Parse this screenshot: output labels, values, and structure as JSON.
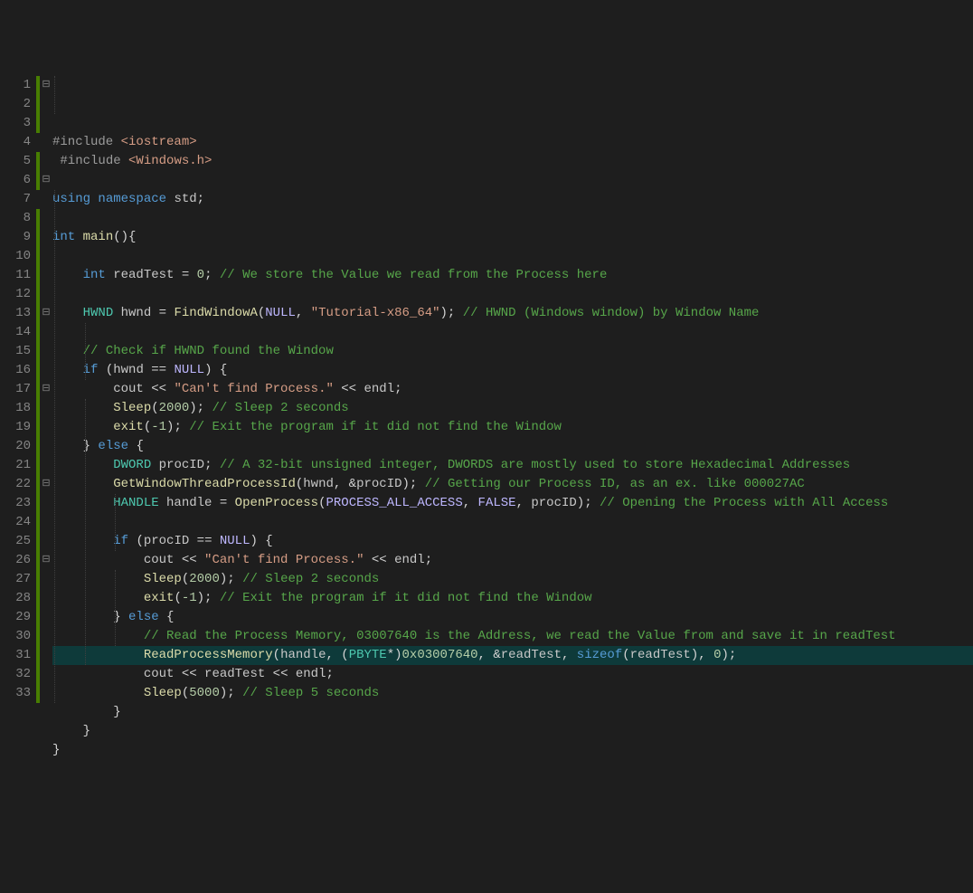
{
  "lineCount": 33,
  "modified": [
    1,
    2,
    3,
    5,
    6,
    8,
    9,
    10,
    11,
    12,
    13,
    14,
    15,
    16,
    17,
    18,
    19,
    20,
    21,
    22,
    23,
    24,
    25,
    26,
    27,
    28,
    29,
    30,
    31,
    32,
    33
  ],
  "fold": {
    "minus": [
      1,
      6,
      13,
      17,
      22,
      26
    ],
    "open": []
  },
  "lines": [
    [
      [
        "pp",
        "#include "
      ],
      [
        "str",
        "<iostream>"
      ]
    ],
    [
      [
        "op",
        " "
      ],
      [
        "pp",
        "#include "
      ],
      [
        "str",
        "<Windows.h>"
      ]
    ],
    [],
    [
      [
        "kw",
        "using "
      ],
      [
        "kw",
        "namespace "
      ],
      [
        "gv",
        "std"
      ],
      [
        "op",
        ";"
      ]
    ],
    [],
    [
      [
        "kw",
        "int "
      ],
      [
        "fn",
        "main"
      ],
      [
        "op",
        "(){"
      ]
    ],
    [],
    [
      [
        "op",
        "    "
      ],
      [
        "kw",
        "int "
      ],
      [
        "gv",
        "readTest"
      ],
      [
        "op",
        " = "
      ],
      [
        "num",
        "0"
      ],
      [
        "op",
        "; "
      ],
      [
        "cm",
        "// We store the Value we read from the Process here"
      ]
    ],
    [],
    [
      [
        "op",
        "    "
      ],
      [
        "ty",
        "HWND "
      ],
      [
        "gv",
        "hwnd"
      ],
      [
        "op",
        " = "
      ],
      [
        "fn",
        "FindWindowA"
      ],
      [
        "op",
        "("
      ],
      [
        "mac",
        "NULL"
      ],
      [
        "op",
        ", "
      ],
      [
        "str",
        "\"Tutorial-x86_64\""
      ],
      [
        "op",
        "); "
      ],
      [
        "cm",
        "// HWND (Windows window) by Window Name"
      ]
    ],
    [],
    [
      [
        "op",
        "    "
      ],
      [
        "cm",
        "// Check if HWND found the Window"
      ]
    ],
    [
      [
        "op",
        "    "
      ],
      [
        "kw",
        "if "
      ],
      [
        "op",
        "("
      ],
      [
        "gv",
        "hwnd"
      ],
      [
        "op",
        " == "
      ],
      [
        "mac",
        "NULL"
      ],
      [
        "op",
        ") {"
      ]
    ],
    [
      [
        "op",
        "        "
      ],
      [
        "gv",
        "cout"
      ],
      [
        "op",
        " << "
      ],
      [
        "str",
        "\"Can't find Process.\""
      ],
      [
        "op",
        " << "
      ],
      [
        "gv",
        "endl"
      ],
      [
        "op",
        ";"
      ]
    ],
    [
      [
        "op",
        "        "
      ],
      [
        "fn",
        "Sleep"
      ],
      [
        "op",
        "("
      ],
      [
        "num",
        "2000"
      ],
      [
        "op",
        "); "
      ],
      [
        "cm",
        "// Sleep 2 seconds"
      ]
    ],
    [
      [
        "op",
        "        "
      ],
      [
        "fn",
        "exit"
      ],
      [
        "op",
        "("
      ],
      [
        "num",
        "-1"
      ],
      [
        "op",
        "); "
      ],
      [
        "cm",
        "// Exit the program if it did not find the Window"
      ]
    ],
    [
      [
        "op",
        "    } "
      ],
      [
        "kw",
        "else "
      ],
      [
        "op",
        "{"
      ]
    ],
    [
      [
        "op",
        "        "
      ],
      [
        "ty",
        "DWORD "
      ],
      [
        "gv",
        "procID"
      ],
      [
        "op",
        "; "
      ],
      [
        "cm",
        "// A 32-bit unsigned integer, DWORDS are mostly used to store Hexadecimal Addresses"
      ]
    ],
    [
      [
        "op",
        "        "
      ],
      [
        "fn",
        "GetWindowThreadProcessId"
      ],
      [
        "op",
        "("
      ],
      [
        "gv",
        "hwnd"
      ],
      [
        "op",
        ", &"
      ],
      [
        "gv",
        "procID"
      ],
      [
        "op",
        "); "
      ],
      [
        "cm",
        "// Getting our Process ID, as an ex. like 000027AC"
      ]
    ],
    [
      [
        "op",
        "        "
      ],
      [
        "ty",
        "HANDLE "
      ],
      [
        "gv",
        "handle"
      ],
      [
        "op",
        " = "
      ],
      [
        "fn",
        "OpenProcess"
      ],
      [
        "op",
        "("
      ],
      [
        "mac",
        "PROCESS_ALL_ACCESS"
      ],
      [
        "op",
        ", "
      ],
      [
        "mac",
        "FALSE"
      ],
      [
        "op",
        ", "
      ],
      [
        "gv",
        "procID"
      ],
      [
        "op",
        "); "
      ],
      [
        "cm",
        "// Opening the Process with All Access"
      ]
    ],
    [],
    [
      [
        "op",
        "        "
      ],
      [
        "kw",
        "if "
      ],
      [
        "op",
        "("
      ],
      [
        "gv",
        "procID"
      ],
      [
        "op",
        " == "
      ],
      [
        "mac",
        "NULL"
      ],
      [
        "op",
        ") {"
      ]
    ],
    [
      [
        "op",
        "            "
      ],
      [
        "gv",
        "cout"
      ],
      [
        "op",
        " << "
      ],
      [
        "str",
        "\"Can't find Process.\""
      ],
      [
        "op",
        " << "
      ],
      [
        "gv",
        "endl"
      ],
      [
        "op",
        ";"
      ]
    ],
    [
      [
        "op",
        "            "
      ],
      [
        "fn",
        "Sleep"
      ],
      [
        "op",
        "("
      ],
      [
        "num",
        "2000"
      ],
      [
        "op",
        "); "
      ],
      [
        "cm",
        "// Sleep 2 seconds"
      ]
    ],
    [
      [
        "op",
        "            "
      ],
      [
        "fn",
        "exit"
      ],
      [
        "op",
        "("
      ],
      [
        "num",
        "-1"
      ],
      [
        "op",
        "); "
      ],
      [
        "cm",
        "// Exit the program if it did not find the Window"
      ]
    ],
    [
      [
        "op",
        "        } "
      ],
      [
        "kw",
        "else "
      ],
      [
        "op",
        "{"
      ]
    ],
    [
      [
        "op",
        "            "
      ],
      [
        "cm",
        "// Read the Process Memory, 03007640 is the Address, we read the Value from and save it in readTest"
      ]
    ],
    [
      [
        "op",
        "            "
      ],
      [
        "fn",
        "ReadProcessMemory"
      ],
      [
        "op",
        "("
      ],
      [
        "gv",
        "handle"
      ],
      [
        "op",
        ", ("
      ],
      [
        "ty",
        "PBYTE"
      ],
      [
        "op",
        "*)"
      ],
      [
        "num",
        "0x03007640"
      ],
      [
        "op",
        ", &"
      ],
      [
        "gv",
        "readTest"
      ],
      [
        "op",
        ", "
      ],
      [
        "kw",
        "sizeof"
      ],
      [
        "op",
        "("
      ],
      [
        "gv",
        "readTest"
      ],
      [
        "op",
        "), "
      ],
      [
        "num",
        "0"
      ],
      [
        "op",
        ");"
      ]
    ],
    [
      [
        "op",
        "            "
      ],
      [
        "gv",
        "cout"
      ],
      [
        "op",
        " << "
      ],
      [
        "gv",
        "readTest"
      ],
      [
        "op",
        " << "
      ],
      [
        "gv",
        "endl"
      ],
      [
        "op",
        ";"
      ]
    ],
    [
      [
        "op",
        "            "
      ],
      [
        "fn",
        "Sleep"
      ],
      [
        "op",
        "("
      ],
      [
        "num",
        "5000"
      ],
      [
        "op",
        "); "
      ],
      [
        "cm",
        "// Sleep 5 seconds"
      ]
    ],
    [
      [
        "op",
        "        }"
      ]
    ],
    [
      [
        "op",
        "    }"
      ]
    ],
    [
      [
        "op",
        "}"
      ]
    ]
  ],
  "indentLevels": [
    0,
    0,
    0,
    0,
    0,
    0,
    1,
    1,
    1,
    1,
    1,
    1,
    1,
    2,
    2,
    2,
    1,
    2,
    2,
    2,
    2,
    2,
    3,
    3,
    3,
    2,
    3,
    3,
    3,
    3,
    2,
    1,
    0
  ],
  "highlightLine": 28,
  "foldGlyphs": {
    "minus": "⊟",
    "plus": "⊞"
  },
  "indentGuideSegments": [
    {
      "col": 0,
      "start": 1,
      "len": 2
    },
    {
      "col": 0,
      "start": 7,
      "len": 27
    },
    {
      "col": 1,
      "start": 14,
      "len": 3
    },
    {
      "col": 1,
      "start": 18,
      "len": 14
    },
    {
      "col": 2,
      "start": 23,
      "len": 3
    },
    {
      "col": 2,
      "start": 27,
      "len": 4
    }
  ]
}
